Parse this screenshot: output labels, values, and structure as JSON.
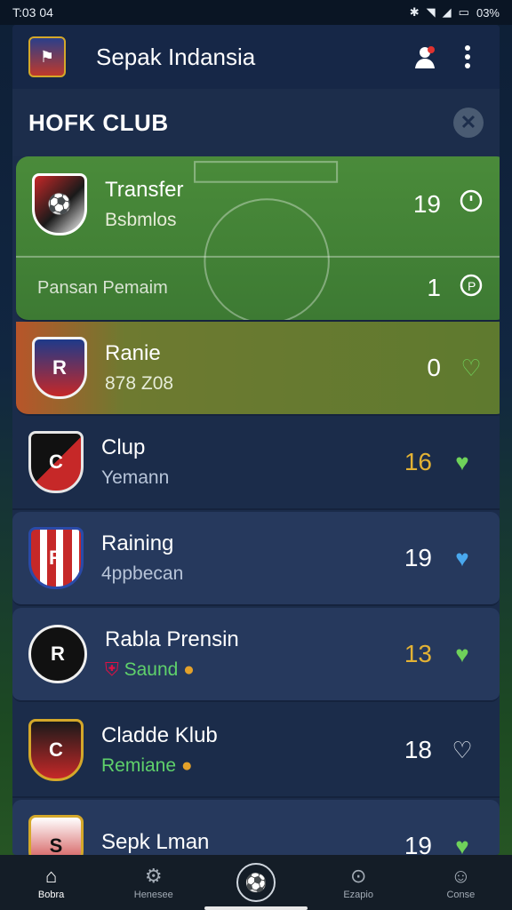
{
  "status": {
    "time": "T:03 04",
    "battery": "03%"
  },
  "app": {
    "title": "Sepak Indansia"
  },
  "section": {
    "title": "HOFK CLUB",
    "clear_glyph": "✕"
  },
  "featured": {
    "name": "Transfer",
    "sub": "Bsbmlos",
    "count": "19",
    "secondary_label": "Pansan Pemaim",
    "secondary_count": "1"
  },
  "items": [
    {
      "name": "Ranie",
      "sub": "878 Z08",
      "count": "0",
      "icon": "heart-outline-green",
      "crest_text": "R"
    },
    {
      "name": "Clup",
      "sub": "Yemann",
      "count": "16",
      "count_style": "gold",
      "icon": "heart-green",
      "crest_text": "C"
    },
    {
      "name": "Raining",
      "sub": "4ppbecan",
      "count": "19",
      "icon": "heart-blue",
      "crest_text": "R"
    },
    {
      "name": "Rabla Prensin",
      "sub": "Saund",
      "count": "13",
      "count_style": "gold",
      "icon": "heart-green",
      "crest_text": "R"
    },
    {
      "name": "Cladde Klub",
      "sub": "Remiane",
      "count": "18",
      "icon": "heart-outline",
      "crest_text": "C"
    },
    {
      "name": "Sepk Lman",
      "sub": "",
      "count": "19",
      "icon": "heart-green",
      "crest_text": "S"
    }
  ],
  "nav": [
    {
      "label": "Bobra",
      "glyph": "⌂"
    },
    {
      "label": "Henesee",
      "glyph": "⚙"
    },
    {
      "label": "",
      "glyph": "⚽"
    },
    {
      "label": "Ezapio",
      "glyph": "⊙"
    },
    {
      "label": "Conse",
      "glyph": "☺"
    }
  ]
}
